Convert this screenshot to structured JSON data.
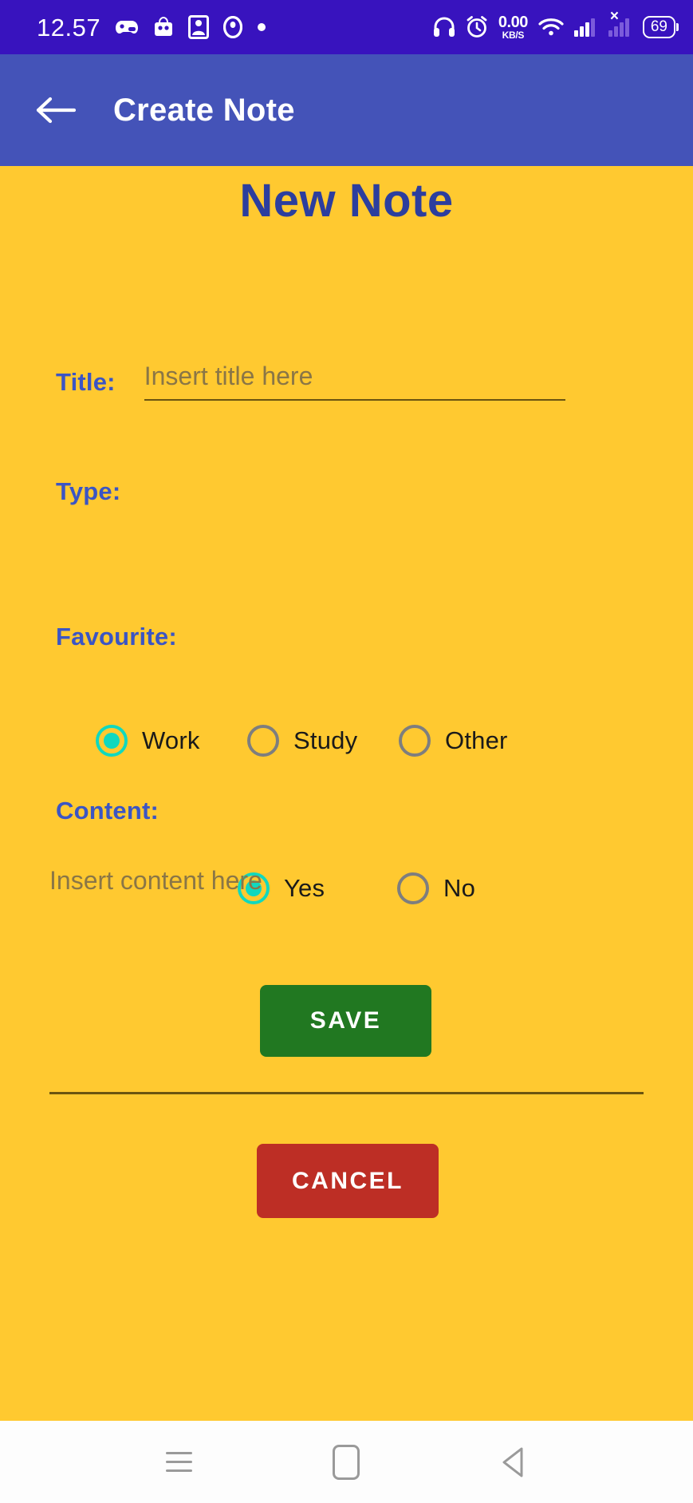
{
  "status_bar": {
    "time": "12.57",
    "network_speed_value": "0.00",
    "network_speed_unit": "KB/S",
    "battery_level": "69",
    "left_icons": [
      "game-controller-icon",
      "shopping-basket-icon",
      "photo-frame-icon",
      "location-pin-icon",
      "dot-icon"
    ],
    "right_icons": [
      "headphones-icon",
      "alarm-clock-icon",
      "wifi-icon",
      "signal-bars-icon",
      "sim-no-service-icon",
      "battery-icon"
    ]
  },
  "app_bar": {
    "back_icon": "back-arrow-icon",
    "title": "Create Note"
  },
  "page": {
    "heading": "New Note"
  },
  "form": {
    "title_field": {
      "label": "Title:",
      "value": "",
      "placeholder": "Insert title here"
    },
    "type_field": {
      "label": "Type:",
      "options": [
        {
          "label": "Work",
          "selected": true
        },
        {
          "label": "Study",
          "selected": false
        },
        {
          "label": "Other",
          "selected": false
        }
      ]
    },
    "favourite_field": {
      "label": "Favourite:",
      "options": [
        {
          "label": "Yes",
          "selected": true
        },
        {
          "label": "No",
          "selected": false
        }
      ]
    },
    "content_field": {
      "label": "Content:",
      "value": "",
      "placeholder": "Insert content here"
    }
  },
  "actions": {
    "save_label": "SAVE",
    "cancel_label": "CANCEL"
  },
  "nav_bar": {
    "recents_icon": "recents-menu-icon",
    "home_icon": "home-icon",
    "back_icon": "back-triangle-icon"
  },
  "colors": {
    "status_bar_bg": "#3813BE",
    "app_bar_bg": "#4453B8",
    "page_bg": "#FFC930",
    "label_blue": "#3B55C4",
    "heading_blue": "#2C3E9E",
    "radio_selected": "#11D8BE",
    "radio_unselected": "#7E7E7E",
    "save_green": "#217821",
    "cancel_red": "#BD2E25"
  }
}
